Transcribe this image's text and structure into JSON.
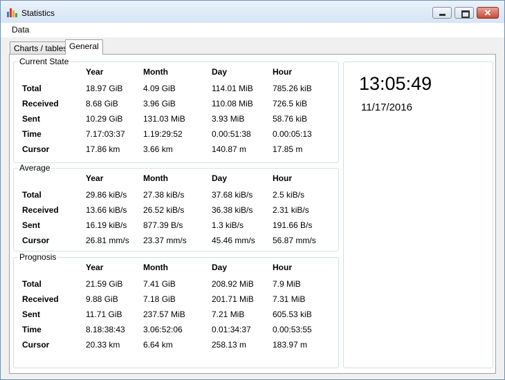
{
  "window": {
    "title": "Statistics"
  },
  "menu": {
    "data_label": "Data"
  },
  "tabs": [
    {
      "label": "Charts / tables",
      "active": false
    },
    {
      "label": "General",
      "active": true
    }
  ],
  "current_state": {
    "title": "Current State",
    "headers": [
      "Year",
      "Month",
      "Day",
      "Hour"
    ],
    "rows": [
      {
        "label": "Total",
        "values": [
          "18.97 GiB",
          "4.09 GiB",
          "114.01 MiB",
          "785.26 kiB"
        ]
      },
      {
        "label": "Received",
        "values": [
          "8.68 GiB",
          "3.96 GiB",
          "110.08 MiB",
          "726.5 kiB"
        ]
      },
      {
        "label": "Sent",
        "values": [
          "10.29 GiB",
          "131.03 MiB",
          "3.93 MiB",
          "58.76 kiB"
        ]
      },
      {
        "label": "Time",
        "values": [
          "7.17:03:37",
          "1.19:29:52",
          "0.00:51:38",
          "0.00:05:13"
        ]
      },
      {
        "label": "Cursor",
        "values": [
          "17.86 km",
          "3.66 km",
          "140.87 m",
          "17.85 m"
        ]
      }
    ]
  },
  "average": {
    "title": "Average",
    "headers": [
      "Year",
      "Month",
      "Day",
      "Hour"
    ],
    "rows": [
      {
        "label": "Total",
        "values": [
          "29.86 kiB/s",
          "27.38 kiB/s",
          "37.68 kiB/s",
          "2.5 kiB/s"
        ]
      },
      {
        "label": "Received",
        "values": [
          "13.66 kiB/s",
          "26.52 kiB/s",
          "36.38 kiB/s",
          "2.31 kiB/s"
        ]
      },
      {
        "label": "Sent",
        "values": [
          "16.19 kiB/s",
          "877.39 B/s",
          "1.3 kiB/s",
          "191.66 B/s"
        ]
      },
      {
        "label": "Cursor",
        "values": [
          "26.81 mm/s",
          "23.37 mm/s",
          "45.46 mm/s",
          "56.87 mm/s"
        ]
      }
    ]
  },
  "prognosis": {
    "title": "Prognosis",
    "headers": [
      "Year",
      "Month",
      "Day",
      "Hour"
    ],
    "rows": [
      {
        "label": "Total",
        "values": [
          "21.59 GiB",
          "7.41 GiB",
          "208.92 MiB",
          "7.9 MiB"
        ]
      },
      {
        "label": "Received",
        "values": [
          "9.88 GiB",
          "7.18 GiB",
          "201.71 MiB",
          "7.31 MiB"
        ]
      },
      {
        "label": "Sent",
        "values": [
          "11.71 GiB",
          "237.57 MiB",
          "7.21 MiB",
          "605.53 kiB"
        ]
      },
      {
        "label": "Time",
        "values": [
          "8.18:38:43",
          "3.06:52:06",
          "0.01:34:37",
          "0.00:53:55"
        ]
      },
      {
        "label": "Cursor",
        "values": [
          "20.33 km",
          "6.64 km",
          "258.13 m",
          "183.97 m"
        ]
      }
    ]
  },
  "clock": {
    "time": "13:05:49",
    "date": "11/17/2016"
  },
  "icons": {
    "app": "bar-chart-icon",
    "minimize": "minimize-icon",
    "maximize": "maximize-icon",
    "close": "close-icon"
  },
  "colors": {
    "close_button": "#c74a36",
    "titlebar": "#dbe7f5",
    "group_border": "#d5dfe5"
  }
}
